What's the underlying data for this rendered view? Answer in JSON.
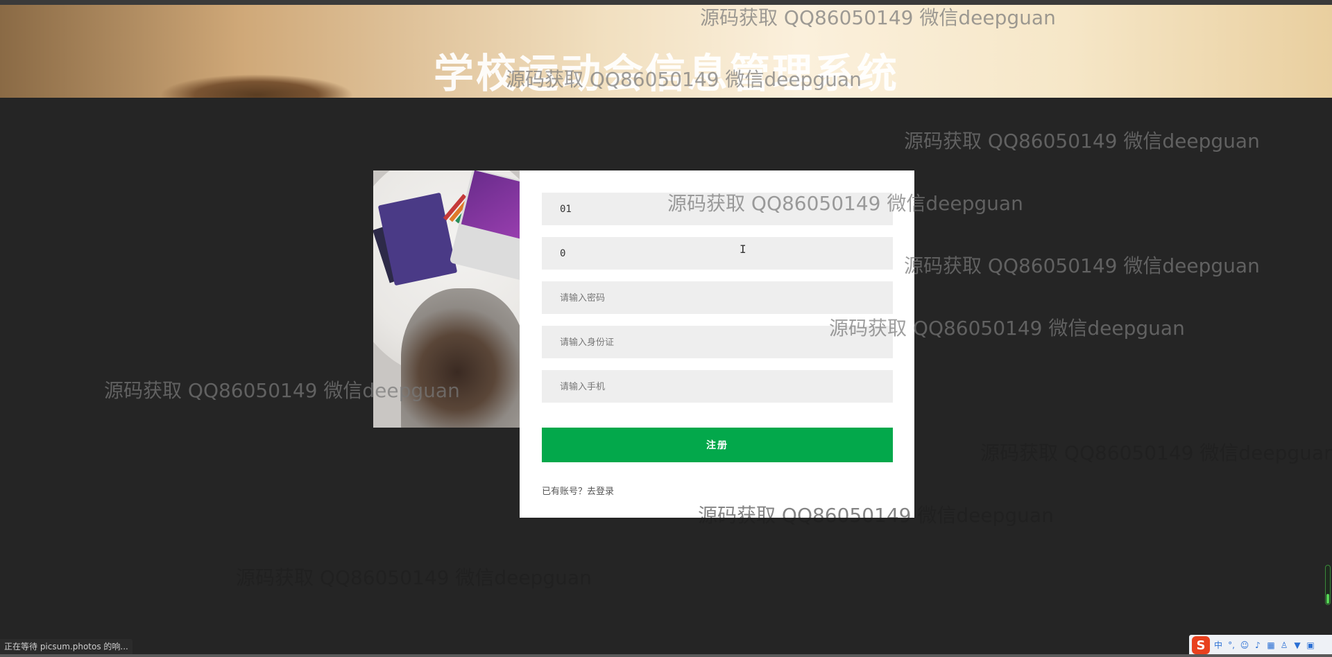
{
  "banner": {
    "title": "学校运动会信息管理系统"
  },
  "register_form": {
    "fields": [
      {
        "value": "01",
        "placeholder": ""
      },
      {
        "value": "0",
        "placeholder": ""
      },
      {
        "value": "",
        "placeholder": "请输入密码"
      },
      {
        "value": "",
        "placeholder": "请输入身份证"
      },
      {
        "value": "",
        "placeholder": "请输入手机"
      }
    ],
    "submit_label": "注册",
    "login_link": "已有账号？去登录"
  },
  "watermark_text": "源码获取 QQ86050149 微信deepguan",
  "browser": {
    "status_text": "正在等待 picsum.photos 的响..."
  },
  "ime": {
    "logo": "S",
    "mode": "中",
    "icons": [
      "punctuation-icon",
      "emoji-icon",
      "mic-icon",
      "keyboard-icon",
      "user-icon",
      "skin-icon",
      "grid-icon"
    ]
  },
  "colors": {
    "submit": "#03a84b",
    "background": "#252525",
    "field_bg": "#eeeeee"
  }
}
